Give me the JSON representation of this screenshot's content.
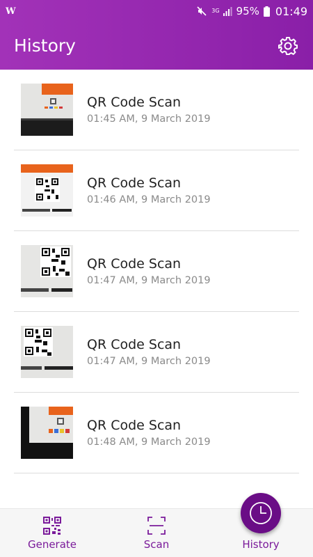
{
  "status_bar": {
    "battery": "95%",
    "time": "01:49",
    "network": "3G"
  },
  "header": {
    "title": "History",
    "settings_icon": "gear-icon"
  },
  "history_items": [
    {
      "title": "QR Code Scan",
      "date": "01:45 AM, 9 March 2019"
    },
    {
      "title": "QR Code Scan",
      "date": "01:46 AM, 9 March 2019"
    },
    {
      "title": "QR Code Scan",
      "date": "01:47 AM, 9 March 2019"
    },
    {
      "title": "QR Code Scan",
      "date": "01:47 AM, 9 March 2019"
    },
    {
      "title": "QR Code Scan",
      "date": "01:48 AM, 9 March 2019"
    }
  ],
  "bottom_nav": {
    "generate_label": "Generate",
    "scan_label": "Scan",
    "history_label": "History"
  },
  "colors": {
    "primary": "#9a28b4",
    "primary_dark": "#6a0d86",
    "nav_text": "#7a1a9a"
  }
}
